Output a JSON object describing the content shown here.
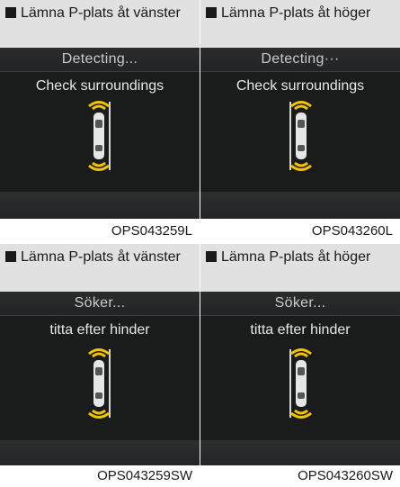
{
  "panels": [
    {
      "caption": "Lämna P-plats åt vänster",
      "status": "Detecting...",
      "message": "Check surroundings",
      "code": "OPS043259L",
      "side": "left"
    },
    {
      "caption": "Lämna P-plats åt höger",
      "status": "Detecting···",
      "message": "Check surroundings",
      "code": "OPS043260L",
      "side": "right"
    },
    {
      "caption": "Lämna P-plats åt vänster",
      "status": "Söker...",
      "message": "titta efter hinder",
      "code": "OPS043259SW",
      "side": "left"
    },
    {
      "caption": "Lämna P-plats åt höger",
      "status": "Söker...",
      "message": "titta efter hinder",
      "code": "OPS043260SW",
      "side": "right"
    }
  ],
  "colors": {
    "sensor": "#f2c500",
    "car": "#e6e6e6",
    "screen": "#1a1c1c"
  },
  "icons": {
    "car": "car-top-view-icon",
    "sensor": "sensor-waves-icon"
  }
}
